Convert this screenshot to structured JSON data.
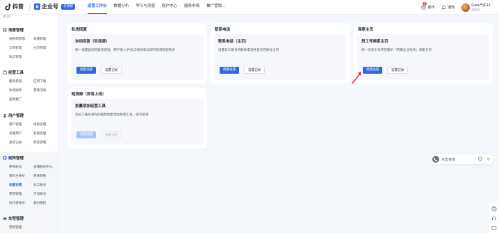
{
  "header": {
    "douyin_label": "抖音",
    "qiyehao_label": "企业号",
    "edition_badge": "云旗舰",
    "nav": [
      {
        "label": "运营工作台",
        "active": true
      },
      {
        "label": "数据分析"
      },
      {
        "label": "学习与灵感"
      },
      {
        "label": "账户中心"
      },
      {
        "label": "服务市场"
      },
      {
        "label": "推广营销"
      }
    ],
    "notification_count": "3",
    "help_label": "操作",
    "message_label": "通知",
    "user_name": "Gaia汽车11",
    "user_tag": "企业号"
  },
  "sidebar": {
    "top_cut": "首页",
    "groups": [
      {
        "title": "场景管理",
        "items": [
          "短视频管理",
          "直播管理",
          "订阅管理",
          "主页管理",
          "私信管理"
        ]
      },
      {
        "title": "经营工具",
        "items": [
          "服务按钮",
          "应用下载",
          "私域组件",
          "营销活动",
          "品牌推广"
        ]
      },
      {
        "title": "用户管理",
        "items": [
          "用户管理",
          "线索管理",
          "高潜用户",
          "客服管理",
          "通话记录",
          "标签管理"
        ]
      },
      {
        "title": "矩阵管理",
        "items": [
          "矩阵账号",
          "直播联动中心",
          "授权主账号",
          "矩阵转账",
          "批量设置",
          "员工账号",
          "矩阵管理",
          "子母账号",
          "协作者账号",
          "素材授权"
        ]
      },
      {
        "title": "车型管理",
        "items": [
          "营销管理"
        ]
      }
    ],
    "active_item": "批量设置"
  },
  "cards": {
    "dm": {
      "title": "私信回复",
      "inner_title": "自动回复（欢迎语）",
      "desc": "统一设置自动回复欢迎语。用户进入子/员工账号私信即可收到欢迎话术",
      "primary": "批量设置",
      "secondary": "设置记录"
    },
    "phone": {
      "title": "联系电话",
      "inner_title": "联系电话（主页）",
      "desc": "设置员工账号的联系电话并显示在账号主页",
      "primary": "批量设置",
      "secondary": "设置记录"
    },
    "merchant": {
      "title": "商家主页",
      "inner_title": "员工号商家主页",
      "desc": "统一为员工号开启展示「所属企业号的」商家主页",
      "primary": "批量设置",
      "secondary": "设置记录"
    },
    "shortvideo": {
      "title": "短视频（即将上线）",
      "inner_title": "批量添加经营工具",
      "desc": "为员工账号发布的视频批量添加经营工具，吸引留资",
      "primary": "批量设置",
      "secondary": "设置记录"
    }
  },
  "consult": {
    "label": "点击咨询"
  },
  "colors": {
    "primary": "#2d6ae0",
    "arrow": "#e53935",
    "page_bg": "#f4f7fc"
  }
}
